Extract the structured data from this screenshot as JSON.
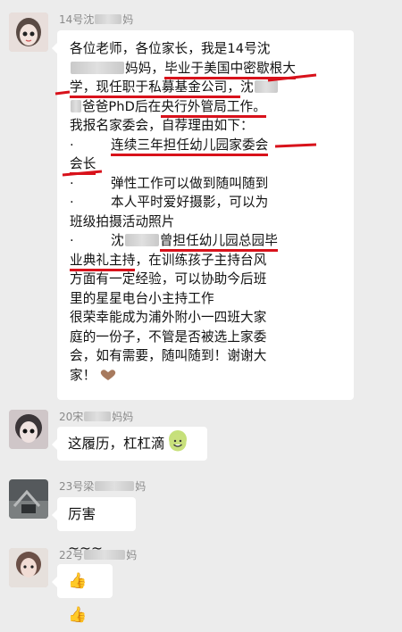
{
  "messages": [
    {
      "sender": "14号沈",
      "sender_suffix": "妈",
      "lines": [
        [
          "各位老师，各位家长，我是14号沈"
        ],
        [
          "妈妈，",
          "毕业于美国中密歇根大"
        ],
        [
          "学，现任职于私募基金公司，",
          "沈"
        ],
        [
          "爸爸PhD后在",
          "央行外管局工作。"
        ],
        [
          "我报名家委会，自荐理由如下："
        ],
        [
          "·",
          "连续三年担任幼儿园家委会"
        ],
        [
          "会长"
        ],
        [
          "·",
          "弹性工作可以做到随叫随到"
        ],
        [
          "·",
          "本人平时爱好摄影，可以为"
        ],
        [
          "班级拍摄活动照片"
        ],
        [
          "·",
          "沈",
          "曾担任幼儿园总园毕"
        ],
        [
          "业典礼主持",
          "，在训练孩子主持台风"
        ],
        [
          "方面有一定经验，可以协助今后班"
        ],
        [
          "里的星星电台小主持工作"
        ],
        [
          "很荣幸能成为浦外附小一四班大家"
        ],
        [
          "庭的一份子，不管是否被选上家委"
        ],
        [
          "会，如有需要，随叫随到！谢谢大"
        ],
        [
          "家！"
        ]
      ]
    },
    {
      "sender": "20宋",
      "sender_suffix": "妈妈",
      "text": "这履历，杠杠滴"
    },
    {
      "sender": "23号梁",
      "sender_suffix": "妈",
      "text": "厉害~~~"
    },
    {
      "sender": "22号",
      "sender_suffix": "妈",
      "text": "👍👍"
    }
  ],
  "icons": {
    "heart": "heart-icon",
    "grin": "grin-emoji-icon",
    "thumbs": "thumbs-up-icon"
  },
  "colors": {
    "highlight": "#d8121b",
    "bubble": "#ffffff",
    "background": "#ececec"
  }
}
